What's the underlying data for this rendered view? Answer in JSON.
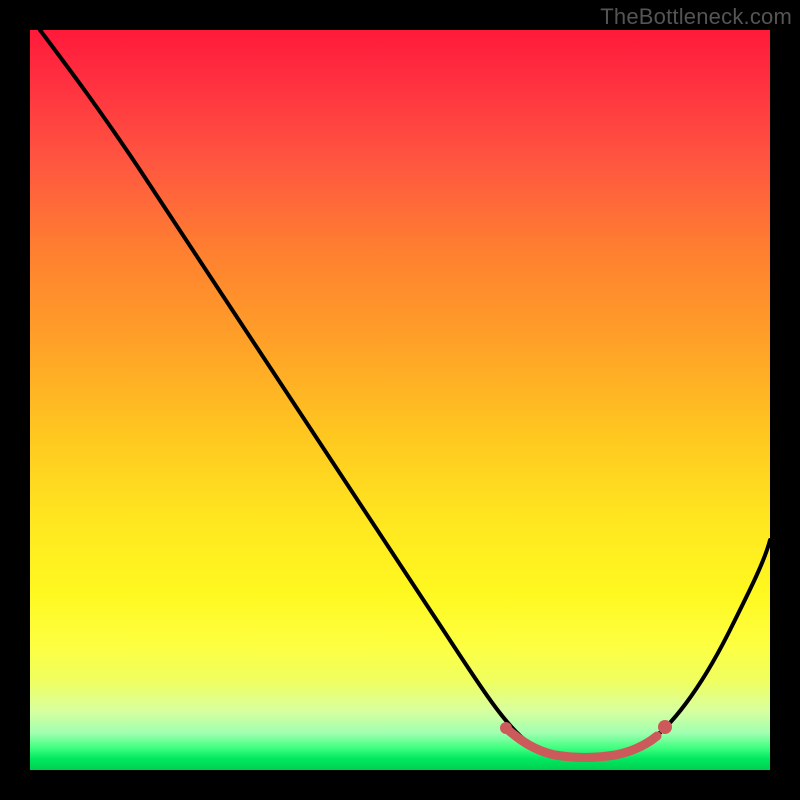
{
  "watermark": "TheBottleneck.com",
  "chart_data": {
    "type": "line",
    "title": "",
    "xlabel": "",
    "ylabel": "",
    "xlim": [
      0,
      100
    ],
    "ylim": [
      0,
      100
    ],
    "series": [
      {
        "name": "curve",
        "x": [
          0,
          6,
          12,
          20,
          30,
          40,
          50,
          58,
          62,
          66,
          70,
          74,
          78,
          82,
          85,
          88,
          92,
          96,
          100
        ],
        "y": [
          100,
          97,
          92,
          82,
          68,
          53,
          39,
          26,
          18,
          11,
          5,
          2,
          1,
          1,
          2,
          5,
          12,
          22,
          33
        ]
      }
    ],
    "highlight_range_x": [
      62,
      85
    ],
    "highlight_color": "#cc5a5a",
    "curve_color": "#000000",
    "background_gradient_stops": [
      {
        "pos": 0,
        "color": "#ff1a3a"
      },
      {
        "pos": 0.55,
        "color": "#ffc820"
      },
      {
        "pos": 0.83,
        "color": "#fdff40"
      },
      {
        "pos": 1.0,
        "color": "#00d050"
      }
    ]
  }
}
